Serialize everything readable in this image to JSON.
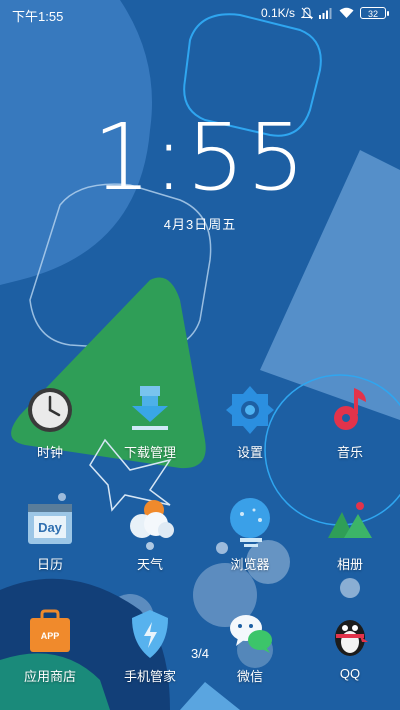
{
  "status_bar": {
    "time": "下午1:55",
    "net_speed": "0.1K/s",
    "battery": "32"
  },
  "lockscreen": {
    "clock": "1:55",
    "date": "4月3日周五"
  },
  "apps": [
    {
      "label": "时钟",
      "icon": "clock-icon"
    },
    {
      "label": "下载管理",
      "icon": "download-icon"
    },
    {
      "label": "设置",
      "icon": "settings-icon"
    },
    {
      "label": "音乐",
      "icon": "music-icon"
    },
    {
      "label": "日历",
      "icon": "calendar-icon"
    },
    {
      "label": "天气",
      "icon": "weather-icon"
    },
    {
      "label": "浏览器",
      "icon": "browser-icon"
    },
    {
      "label": "相册",
      "icon": "gallery-icon"
    },
    {
      "label": "应用商店",
      "icon": "app-store-icon"
    },
    {
      "label": "手机管家",
      "icon": "security-icon"
    },
    {
      "label": "微信",
      "icon": "wechat-icon"
    },
    {
      "label": "QQ",
      "icon": "qq-icon"
    }
  ],
  "calendar_icon_text": "Day",
  "app_store_icon_text": "APP",
  "page_indicator": "3/4",
  "colors": {
    "wallpaper_base": "#1d5fa3",
    "accent_green": "#2f9e57",
    "text": "#ffffff"
  }
}
